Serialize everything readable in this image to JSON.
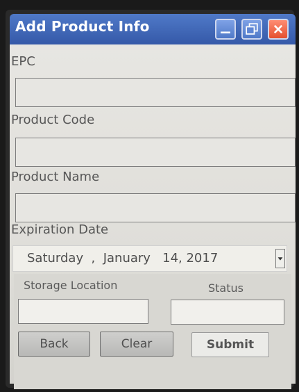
{
  "window": {
    "title": "Add Product Info"
  },
  "fields": {
    "epc_label": "EPC",
    "epc_value": "",
    "product_code_label": "Product Code",
    "product_code_value": "",
    "product_name_label": "Product Name",
    "product_name_value": "",
    "expiration_label": "Expiration Date"
  },
  "date": {
    "value": "Saturday  ,  January   14, 2017"
  },
  "location_status": {
    "storage_label": "Storage Location",
    "storage_value": "",
    "status_label": "Status",
    "status_value": ""
  },
  "buttons": {
    "back": "Back",
    "clear": "Clear",
    "submit": "Submit"
  },
  "icons": {
    "minimize": "minimize-icon",
    "restore": "restore-icon",
    "close": "close-icon",
    "dropdown": "chevron-down-icon"
  }
}
